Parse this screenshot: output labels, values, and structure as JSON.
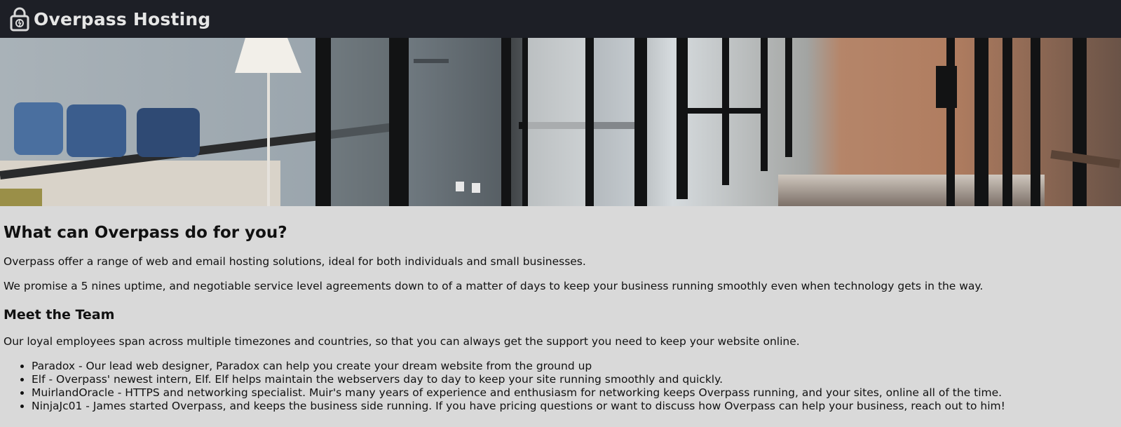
{
  "header": {
    "title": "Overpass Hosting",
    "icon": "padlock-icon"
  },
  "hero": {
    "icon": "office-hallway-photo"
  },
  "main": {
    "heading": "What can Overpass do for you?",
    "paragraph1": "Overpass offer a range of web and email hosting solutions, ideal for both individuals and small businesses.",
    "paragraph2": "We promise a 5 nines uptime, and negotiable service level agreements down to of a matter of days to keep your business running smoothly even when technology gets in the way."
  },
  "team": {
    "heading": "Meet the Team",
    "intro": "Our loyal employees span across multiple timezones and countries, so that you can always get the support you need to keep your website online.",
    "members": [
      "Paradox - Our lead web designer, Paradox can help you create your dream website from the ground up",
      "Elf - Overpass' newest intern, Elf. Elf helps maintain the webservers day to day to keep your site running smoothly and quickly.",
      "MuirlandOracle - HTTPS and networking specialist. Muir's many years of experience and enthusiasm for networking keeps Overpass running, and your sites, online all of the time.",
      "NinjaJc01 - James started Overpass, and keeps the business side running. If you have pricing questions or want to discuss how Overpass can help your business, reach out to him!"
    ]
  },
  "colors": {
    "navbar": "#1d1f26",
    "page_background": "#d9d9d9",
    "title_text": "#e6e6e6"
  }
}
